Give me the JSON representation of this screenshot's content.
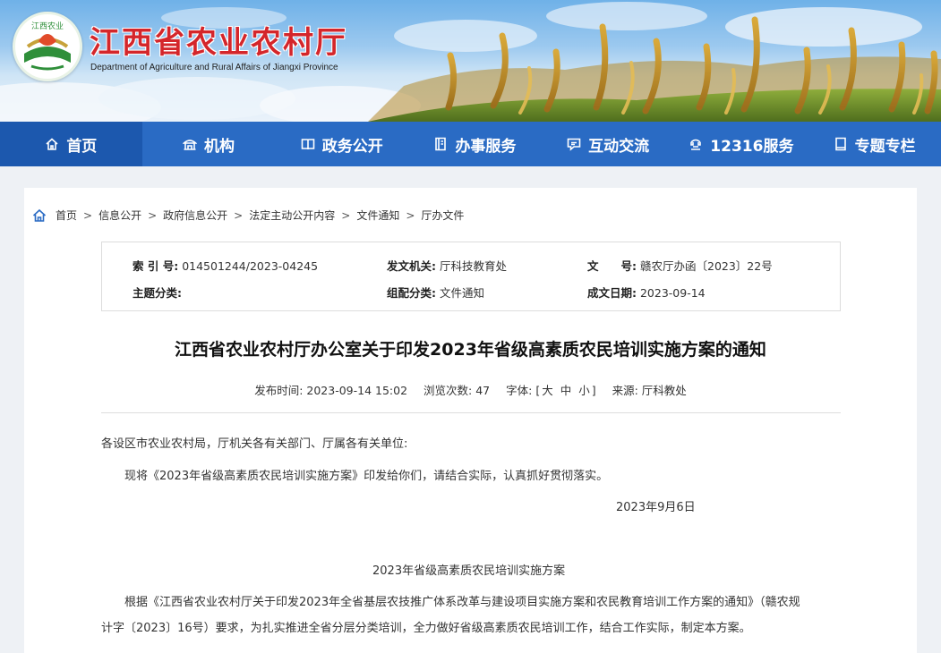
{
  "header": {
    "title": "江西省农业农村厅",
    "subtitle": "Department of Agriculture and Rural Affairs of Jiangxi Province",
    "logo_icon": "jiangxi-agri-logo"
  },
  "nav": {
    "items": [
      {
        "label": "首页",
        "icon": "home-icon"
      },
      {
        "label": "机构",
        "icon": "institution-icon"
      },
      {
        "label": "政务公开",
        "icon": "book-icon"
      },
      {
        "label": "办事服务",
        "icon": "document-icon"
      },
      {
        "label": "互动交流",
        "icon": "chat-icon"
      },
      {
        "label": "12316服务",
        "icon": "hotline-icon"
      },
      {
        "label": "专题专栏",
        "icon": "bookmark-icon"
      }
    ],
    "active_color": "#1c58ae",
    "bar_color": "#2a6bc4"
  },
  "breadcrumb": {
    "items": [
      "首页",
      "信息公开",
      "政府信息公开",
      "法定主动公开内容",
      "文件通知",
      "厅办文件"
    ],
    "separator": ">"
  },
  "meta": {
    "index_label": "索 引 号:",
    "index_value": "014501244/2023-04245",
    "issuer_label": "发文机关:",
    "issuer_value": "厅科技教育处",
    "docno_label": "文　　号:",
    "docno_value": "赣农厅办函〔2023〕22号",
    "topic_label": "主题分类:",
    "topic_value": "",
    "category_label": "组配分类:",
    "category_value": "文件通知",
    "date_label": "成文日期:",
    "date_value": "2023-09-14"
  },
  "article": {
    "title": "江西省农业农村厅办公室关于印发2023年省级高素质农民培训实施方案的通知",
    "publish_label": "发布时间:",
    "publish_value": "2023-09-14 15:02",
    "views_label": "浏览次数:",
    "views_value": "47",
    "fontsize_label": "字体:",
    "fontsize_open": "[",
    "fontsize_large": "大",
    "fontsize_medium": "中",
    "fontsize_small": "小",
    "fontsize_close": "]",
    "source_label": "来源:",
    "source_value": "厅科教处",
    "salutation": "各设区市农业农村局，厅机关各有关部门、厅属各有关单位:",
    "body1": "现将《2023年省级高素质农民培训实施方案》印发给你们，请结合实际，认真抓好贯彻落实。",
    "sign_date": "2023年9月6日",
    "plan_title": "2023年省级高素质农民培训实施方案",
    "body2_line1": "根据《江西省农业农村厅关于印发2023年全省基层农技推广体系改革与建设项目实施方案和农民教育培训工作方案的通知》（赣农规",
    "body2_line2": "计字〔2023〕16号）要求，为扎实推进全省分层分类培训，全力做好省级高素质农民培训工作，结合工作实际，制定本方案。"
  }
}
